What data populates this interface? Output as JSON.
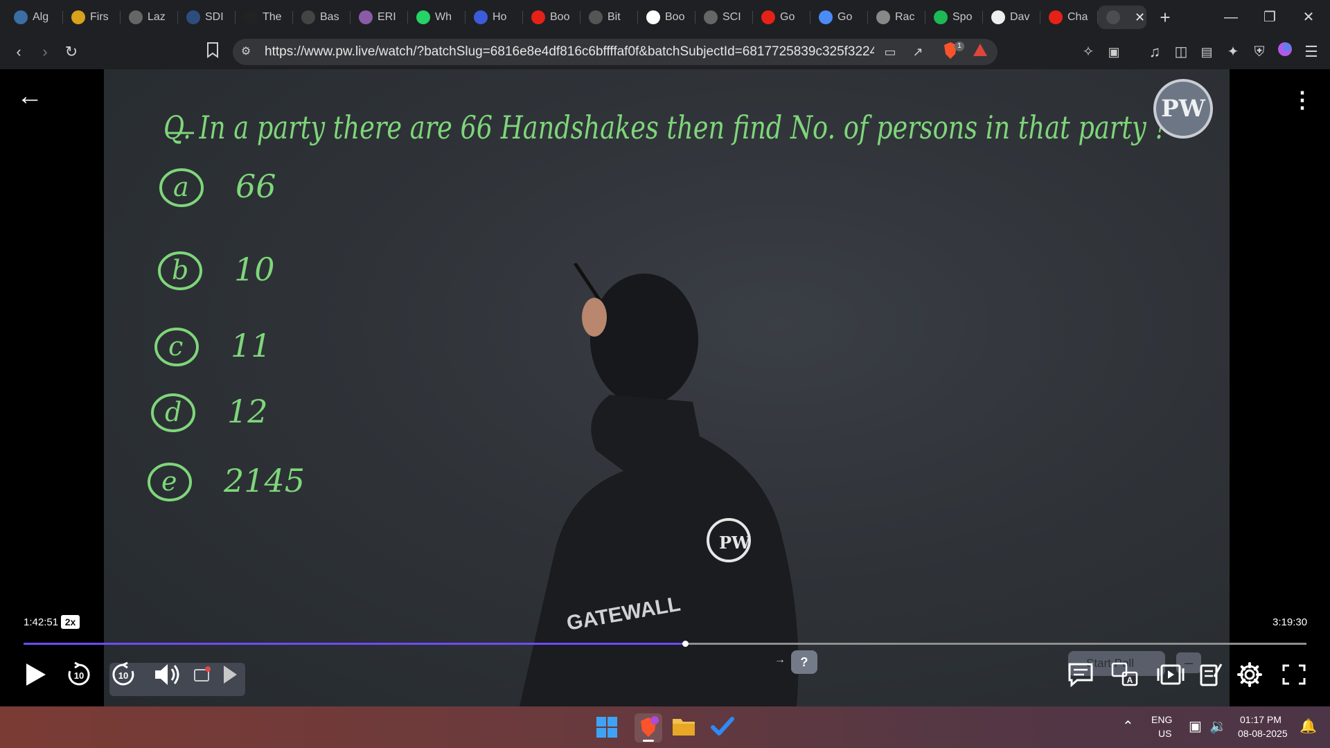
{
  "browser": {
    "tabs": [
      {
        "label": "Alg",
        "icon": "globe-icon",
        "color": "#3a6ea5"
      },
      {
        "label": "Firs",
        "icon": "bolt-icon",
        "color": "#d9a21b"
      },
      {
        "label": "Laz",
        "icon": "globe-icon",
        "color": "#666"
      },
      {
        "label": "SDI",
        "icon": "bars-icon",
        "color": "#2d4e7d"
      },
      {
        "label": "The",
        "icon": "w3-icon",
        "color": "#222"
      },
      {
        "label": "Bas",
        "icon": "brand-icon",
        "color": "#444"
      },
      {
        "label": "ERI",
        "icon": "brain-icon",
        "color": "#8a5ca8"
      },
      {
        "label": "Wh",
        "icon": "whatsapp-icon",
        "color": "#25d366"
      },
      {
        "label": "Ho",
        "icon": "shield-icon",
        "color": "#3b5bdb"
      },
      {
        "label": "Boo",
        "icon": "youtube-icon",
        "color": "#e62117"
      },
      {
        "label": "Bit",
        "icon": "bits-icon",
        "color": "#555"
      },
      {
        "label": "Boo",
        "icon": "google-icon",
        "color": "#ffffff"
      },
      {
        "label": "SCI",
        "icon": "globe-icon",
        "color": "#666"
      },
      {
        "label": "Go",
        "icon": "youtube-icon",
        "color": "#e62117"
      },
      {
        "label": "Go",
        "icon": "gemini-icon",
        "color": "#4b8bf5"
      },
      {
        "label": "Rac",
        "icon": "openai-icon",
        "color": "#888"
      },
      {
        "label": "Spo",
        "icon": "spotify-icon",
        "color": "#1db954"
      },
      {
        "label": "Dav",
        "icon": "wikipedia-icon",
        "color": "#eee"
      },
      {
        "label": "Cha",
        "icon": "youtube-icon",
        "color": "#e62117"
      }
    ],
    "active_tab_icon": "pw-icon",
    "new_tab_label": "+",
    "url": "https://www.pw.live/watch/?batchSlug=6816e8e4df816c6bffffaf0f&batchSubjectId=6817725839c325f3224e28d...",
    "extension_badge": "1"
  },
  "board": {
    "question": "Q. In a party there are 66 Handshakes then find No. of persons in that party ?",
    "options": [
      {
        "key": "a",
        "text": "66"
      },
      {
        "key": "b",
        "text": "10"
      },
      {
        "key": "c",
        "text": "11"
      },
      {
        "key": "d",
        "text": "12"
      },
      {
        "key": "e",
        "text": "2145"
      }
    ],
    "logo_text": "PW",
    "shirt_text": "GATEWALL"
  },
  "player": {
    "time_current": "1:42:51",
    "speed": "2x",
    "time_total": "3:19:30",
    "progress_fraction": 0.5157,
    "skip_back_label": "10",
    "skip_forward_label": "10",
    "helper_label": "?",
    "poll_label": "Start Poll",
    "accent_color": "#6f4bff"
  },
  "taskbar": {
    "lang_top": "ENG",
    "lang_bottom": "US",
    "time": "01:17 PM",
    "date": "08-08-2025"
  }
}
